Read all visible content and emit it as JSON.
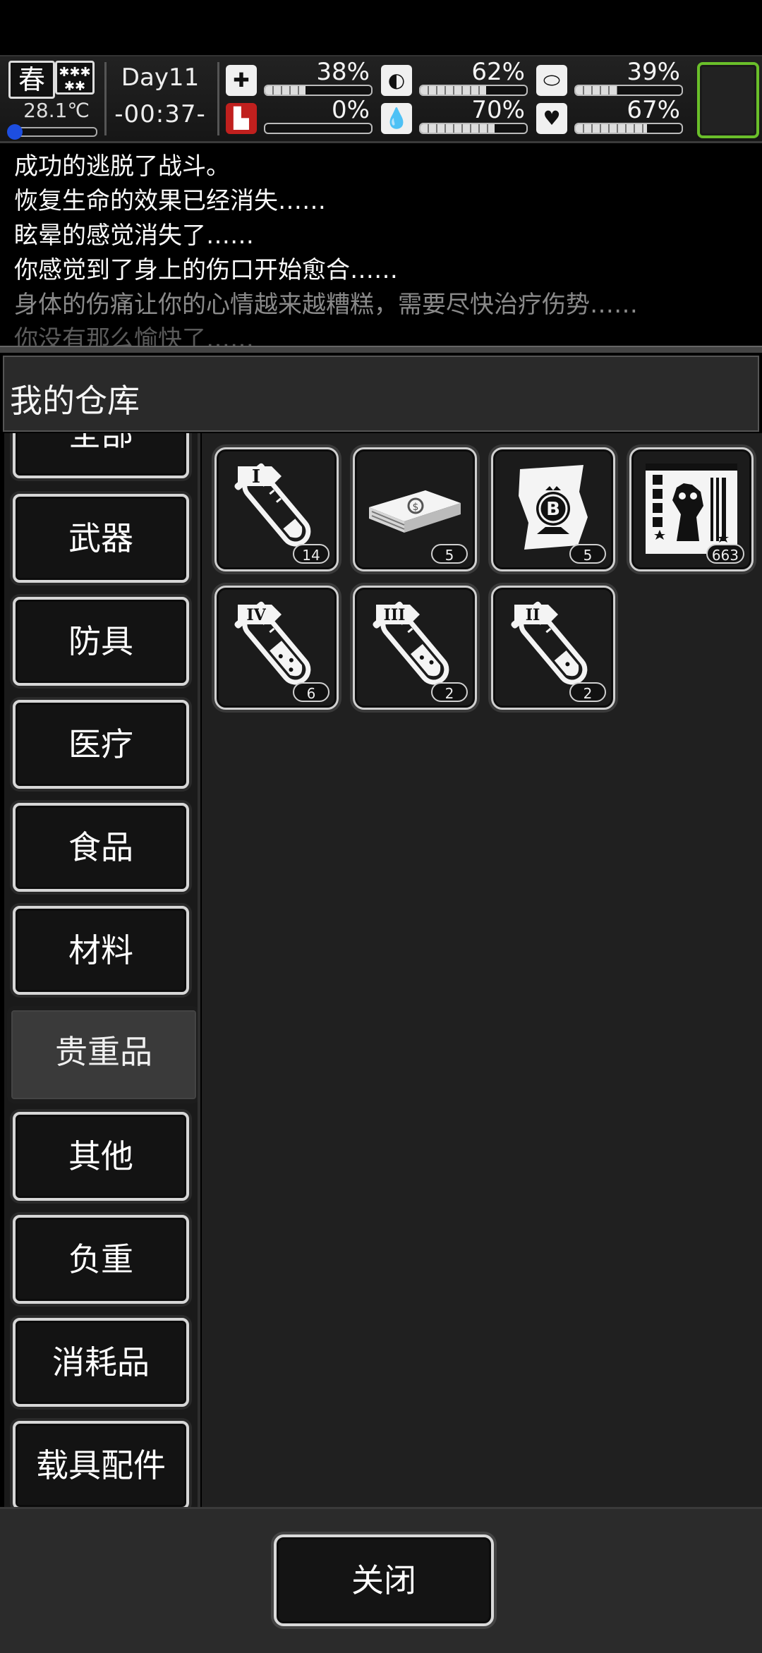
{
  "status": {
    "season": "春",
    "weather_icon": "snow-icon",
    "temperature": "28.1℃",
    "day": "Day11",
    "time": "-00:37-",
    "stats": [
      {
        "name": "health",
        "icon": "medkit-icon",
        "percent": "38%",
        "value": 38
      },
      {
        "name": "hunger",
        "icon": "stomach-icon",
        "percent": "62%",
        "value": 62
      },
      {
        "name": "medicine",
        "icon": "pill-icon",
        "percent": "39%",
        "value": 39
      },
      {
        "name": "injury",
        "icon": "leg-icon",
        "percent": "0%",
        "value": 0
      },
      {
        "name": "thirst",
        "icon": "water-drop-icon",
        "percent": "70%",
        "value": 70
      },
      {
        "name": "mood",
        "icon": "heart-icon",
        "percent": "67%",
        "value": 67
      }
    ]
  },
  "log": [
    "成功的逃脱了战斗。",
    "恢复生命的效果已经消失……",
    "眩晕的感觉消失了……",
    "你感觉到了身上的伤口开始愈合……",
    "身体的伤痛让你的心情越来越糟糕，需要尽快治疗伤势……",
    "你没有那么愉快了……"
  ],
  "panel": {
    "title": "我的仓库",
    "categories": [
      {
        "label": "全部"
      },
      {
        "label": "武器"
      },
      {
        "label": "防具"
      },
      {
        "label": "医疗"
      },
      {
        "label": "食品"
      },
      {
        "label": "材料"
      },
      {
        "label": "贵重品",
        "active": true
      },
      {
        "label": "其他"
      },
      {
        "label": "负重"
      },
      {
        "label": "消耗品"
      },
      {
        "label": "载具配件"
      }
    ],
    "items": [
      {
        "icon": "test-tube-I-icon",
        "count": "14"
      },
      {
        "icon": "cash-stack-icon",
        "count": "5"
      },
      {
        "icon": "bitcoin-map-icon",
        "count": "5"
      },
      {
        "icon": "zombie-card-icon",
        "count": "663"
      },
      {
        "icon": "test-tube-IV-icon",
        "count": "6"
      },
      {
        "icon": "test-tube-III-icon",
        "count": "2"
      },
      {
        "icon": "test-tube-II-icon",
        "count": "2"
      }
    ],
    "close_label": "关闭"
  },
  "colors": {
    "accent_green": "#6abf2a",
    "temp_blue": "#1d4ee0",
    "injury_red": "#c0201e"
  }
}
